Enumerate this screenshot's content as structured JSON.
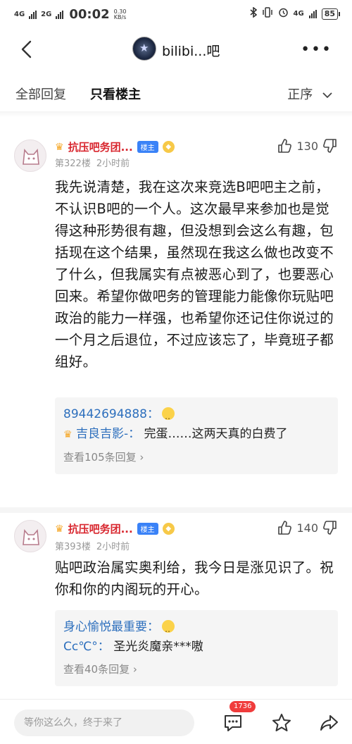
{
  "status_bar": {
    "net1": "4G",
    "net2": "2G",
    "time": "00:02",
    "speed_value": "0.30",
    "speed_unit": "KB/s",
    "net_right": "4G",
    "battery": "85"
  },
  "header": {
    "title": "bilibi...吧"
  },
  "tabs": {
    "all": "全部回复",
    "op_only": "只看楼主",
    "sort": "正序"
  },
  "posts": [
    {
      "author": "抗压吧务团...",
      "badge": "楼主",
      "floor": "第322楼",
      "time": "2小时前",
      "likes": "130",
      "content": "我先说清楚，我在这次来竞选B吧吧主之前，不认识B吧的一个人。这次最早来参加也是觉得这种形势很有趣，但没想到会这么有趣，包括现在这个结果，虽然现在我这么做也改变不了什么，但我属实有点被恶心到了，也要恶心回来。希望你做吧务的管理能力能像你玩贴吧政治的能力一样强，也希望你还记住你说过的一个月之后退位，不过应该忘了，毕竟班子都组好。",
      "replies": [
        {
          "name": "89442694888：",
          "text": ""
        },
        {
          "name": "吉良吉影-：",
          "text": "完蛋……这两天真的白费了"
        }
      ],
      "view_more": "查看105条回复"
    },
    {
      "author": "抗压吧务团...",
      "badge": "楼主",
      "floor": "第393楼",
      "time": "2小时前",
      "likes": "140",
      "content": "贴吧政治属实奥利给，我今日是涨见识了。祝你和你的内阁玩的开心。",
      "replies": [
        {
          "name": "身心愉悦最重要：",
          "text": ""
        },
        {
          "name": "Cc℃°：",
          "text": "圣光炎魔亲***嗷"
        }
      ],
      "view_more": "查看40条回复"
    }
  ],
  "bottom_bar": {
    "placeholder": "等你这么久，终于来了",
    "comment_count": "1736"
  }
}
